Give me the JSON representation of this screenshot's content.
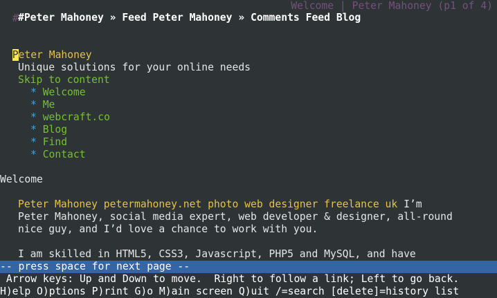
{
  "title_bar": {
    "hash": "#",
    "page_title": "Welcome | Peter Mahoney (p1 of 4)"
  },
  "header_links": "#Peter Mahoney » Feed Peter Mahoney » Comments Feed Blog",
  "site_name_first_char": "P",
  "site_name_rest": "eter Mahoney",
  "tagline": "Unique solutions for your online needs",
  "skip_link": "Skip to content",
  "nav": {
    "bullet": "*",
    "items": [
      "Welcome",
      "Me",
      "webcraft.co",
      "Blog",
      "Find",
      "Contact"
    ]
  },
  "page_heading": "Welcome",
  "body": {
    "link_text": "Peter Mahoney petermahoney.net photo web designer freelance uk",
    "line1_rest": " I’m",
    "line2": "Peter Mahoney, social media expert, web developer & designer, all-round",
    "line3": "nice guy, and I’d love a chance to work with you.",
    "line4": "I am skilled in HTML5, CSS3, Javascript, PHP5 and MySQL, and have"
  },
  "status": {
    "more_prompt": "-- press space for next page --",
    "help_line": " Arrow keys: Up and Down to move.  Right to follow a link; Left to go back.",
    "commands": "H)elp O)ptions P)rint G)o M)ain screen Q)uit /=search [delete]=history list"
  }
}
